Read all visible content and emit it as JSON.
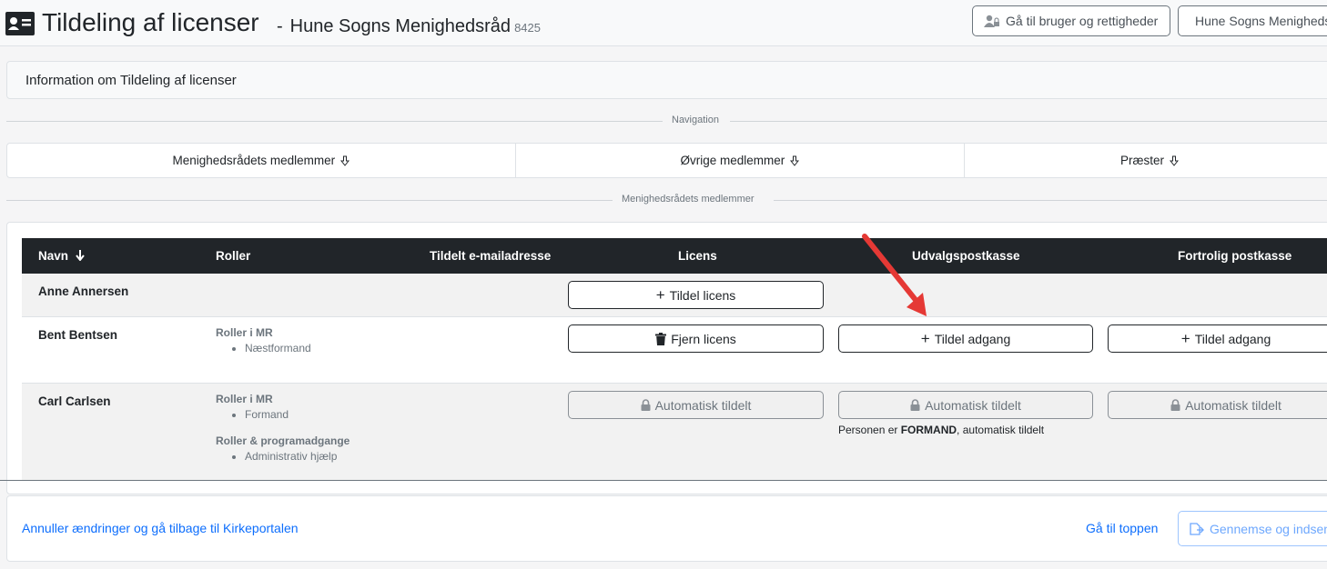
{
  "header": {
    "title": "Tildeling af licenser",
    "separator": "-",
    "org_name": "Hune Sogns Menighedsråd",
    "org_code": "8425",
    "goto_users_button": "Gå til bruger og rettigheder",
    "org_button": "Hune Sogns Menighedsråd"
  },
  "info": {
    "label": "Information om Tildeling af licenser"
  },
  "navigation": {
    "label": "Navigation",
    "items": [
      {
        "label": "Menighedsrådets medlemmer",
        "icon": "arrow-down-icon"
      },
      {
        "label": "Øvrige medlemmer",
        "icon": "arrow-down-icon"
      },
      {
        "label": "Præster",
        "icon": "arrow-down-icon"
      }
    ]
  },
  "section": {
    "label": "Menighedsrådets medlemmer"
  },
  "table": {
    "headers": {
      "name": "Navn",
      "roles": "Roller",
      "email": "Tildelt e-mailadresse",
      "license": "Licens",
      "committee": "Udvalgspostkasse",
      "confidential": "Fortrolig postkasse"
    },
    "rows": [
      {
        "name": "Anne Annersen",
        "license_button": "Tildel licens"
      },
      {
        "name": "Bent Bentsen",
        "role_group": "Roller i MR",
        "role": "Næstformand",
        "license_button": "Fjern licens",
        "committee_button": "Tildel adgang",
        "confidential_button": "Tildel adgang"
      },
      {
        "name": "Carl Carlsen",
        "role_group": "Roller i MR",
        "role": "Formand",
        "role_group2": "Roller & programadgange",
        "role2": "Administrativ hjælp",
        "license_button": "Automatisk tildelt",
        "committee_button": "Automatisk tildelt",
        "confidential_button": "Automatisk tildelt",
        "note_prefix": "Personen er",
        "note_strong": "FORMAND",
        "note_suffix": ", automatisk tildelt"
      }
    ]
  },
  "footer": {
    "cancel_link": "Annuller ændringer og gå tilbage til Kirkeportalen",
    "top_link": "Gå til toppen",
    "review_button": "Gennemse og indsend"
  },
  "colors": {
    "header_dark": "#212529",
    "link": "#0d6efd",
    "arrow": "#e53935"
  }
}
